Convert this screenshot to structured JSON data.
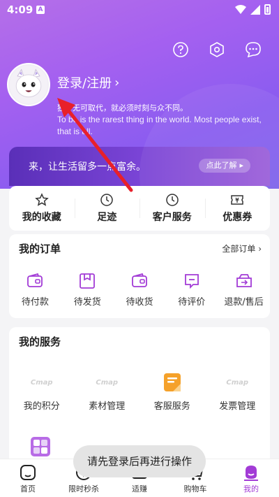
{
  "status": {
    "time": "4:09",
    "sim_label": "A"
  },
  "colors": {
    "accent": "#a23bd6",
    "hero_start": "#b56fe8",
    "hero_end": "#7d63ea",
    "arrow": "#e8202a"
  },
  "top_icons": [
    "help-icon",
    "settings-hex-icon",
    "message-icon"
  ],
  "profile": {
    "login_label": "登录/注册",
    "quote_cn": "独一无可取代，就必须时刻与众不同。",
    "quote_en_1": "To be is the rarest thing in the world. Most people exist,",
    "quote_en_2": "that is all."
  },
  "banner": {
    "text": "来，让生活留多一点富余。",
    "button": "点此了解"
  },
  "quick_links": [
    {
      "label": "我的收藏",
      "icon": "star-icon"
    },
    {
      "label": "足迹",
      "icon": "clock-icon"
    },
    {
      "label": "客户服务",
      "icon": "clock-icon"
    },
    {
      "label": "优惠券",
      "icon": "coupon-icon"
    }
  ],
  "orders": {
    "title": "我的订单",
    "all_link": "全部订单",
    "items": [
      {
        "label": "待付款",
        "icon": "wallet-icon"
      },
      {
        "label": "待发货",
        "icon": "package-icon"
      },
      {
        "label": "待收货",
        "icon": "wallet-icon"
      },
      {
        "label": "待评价",
        "icon": "comment-icon"
      },
      {
        "label": "退款/售后",
        "icon": "refund-icon"
      }
    ]
  },
  "services": {
    "title": "我的服务",
    "items": [
      {
        "label": "我的积分",
        "logo": "Cmap"
      },
      {
        "label": "素材管理",
        "logo": "Cmap"
      },
      {
        "label": "客服服务",
        "logo": ""
      },
      {
        "label": "发票管理",
        "logo": "Cmap"
      }
    ]
  },
  "toast": "请先登录后再进行操作",
  "tabs": [
    {
      "label": "首页",
      "icon": "home-icon"
    },
    {
      "label": "限时秒杀",
      "icon": "flash-sale-icon"
    },
    {
      "label": "适赚",
      "icon": "earn-icon"
    },
    {
      "label": "购物车",
      "icon": "cart-icon"
    },
    {
      "label": "我的",
      "icon": "profile-icon"
    }
  ]
}
